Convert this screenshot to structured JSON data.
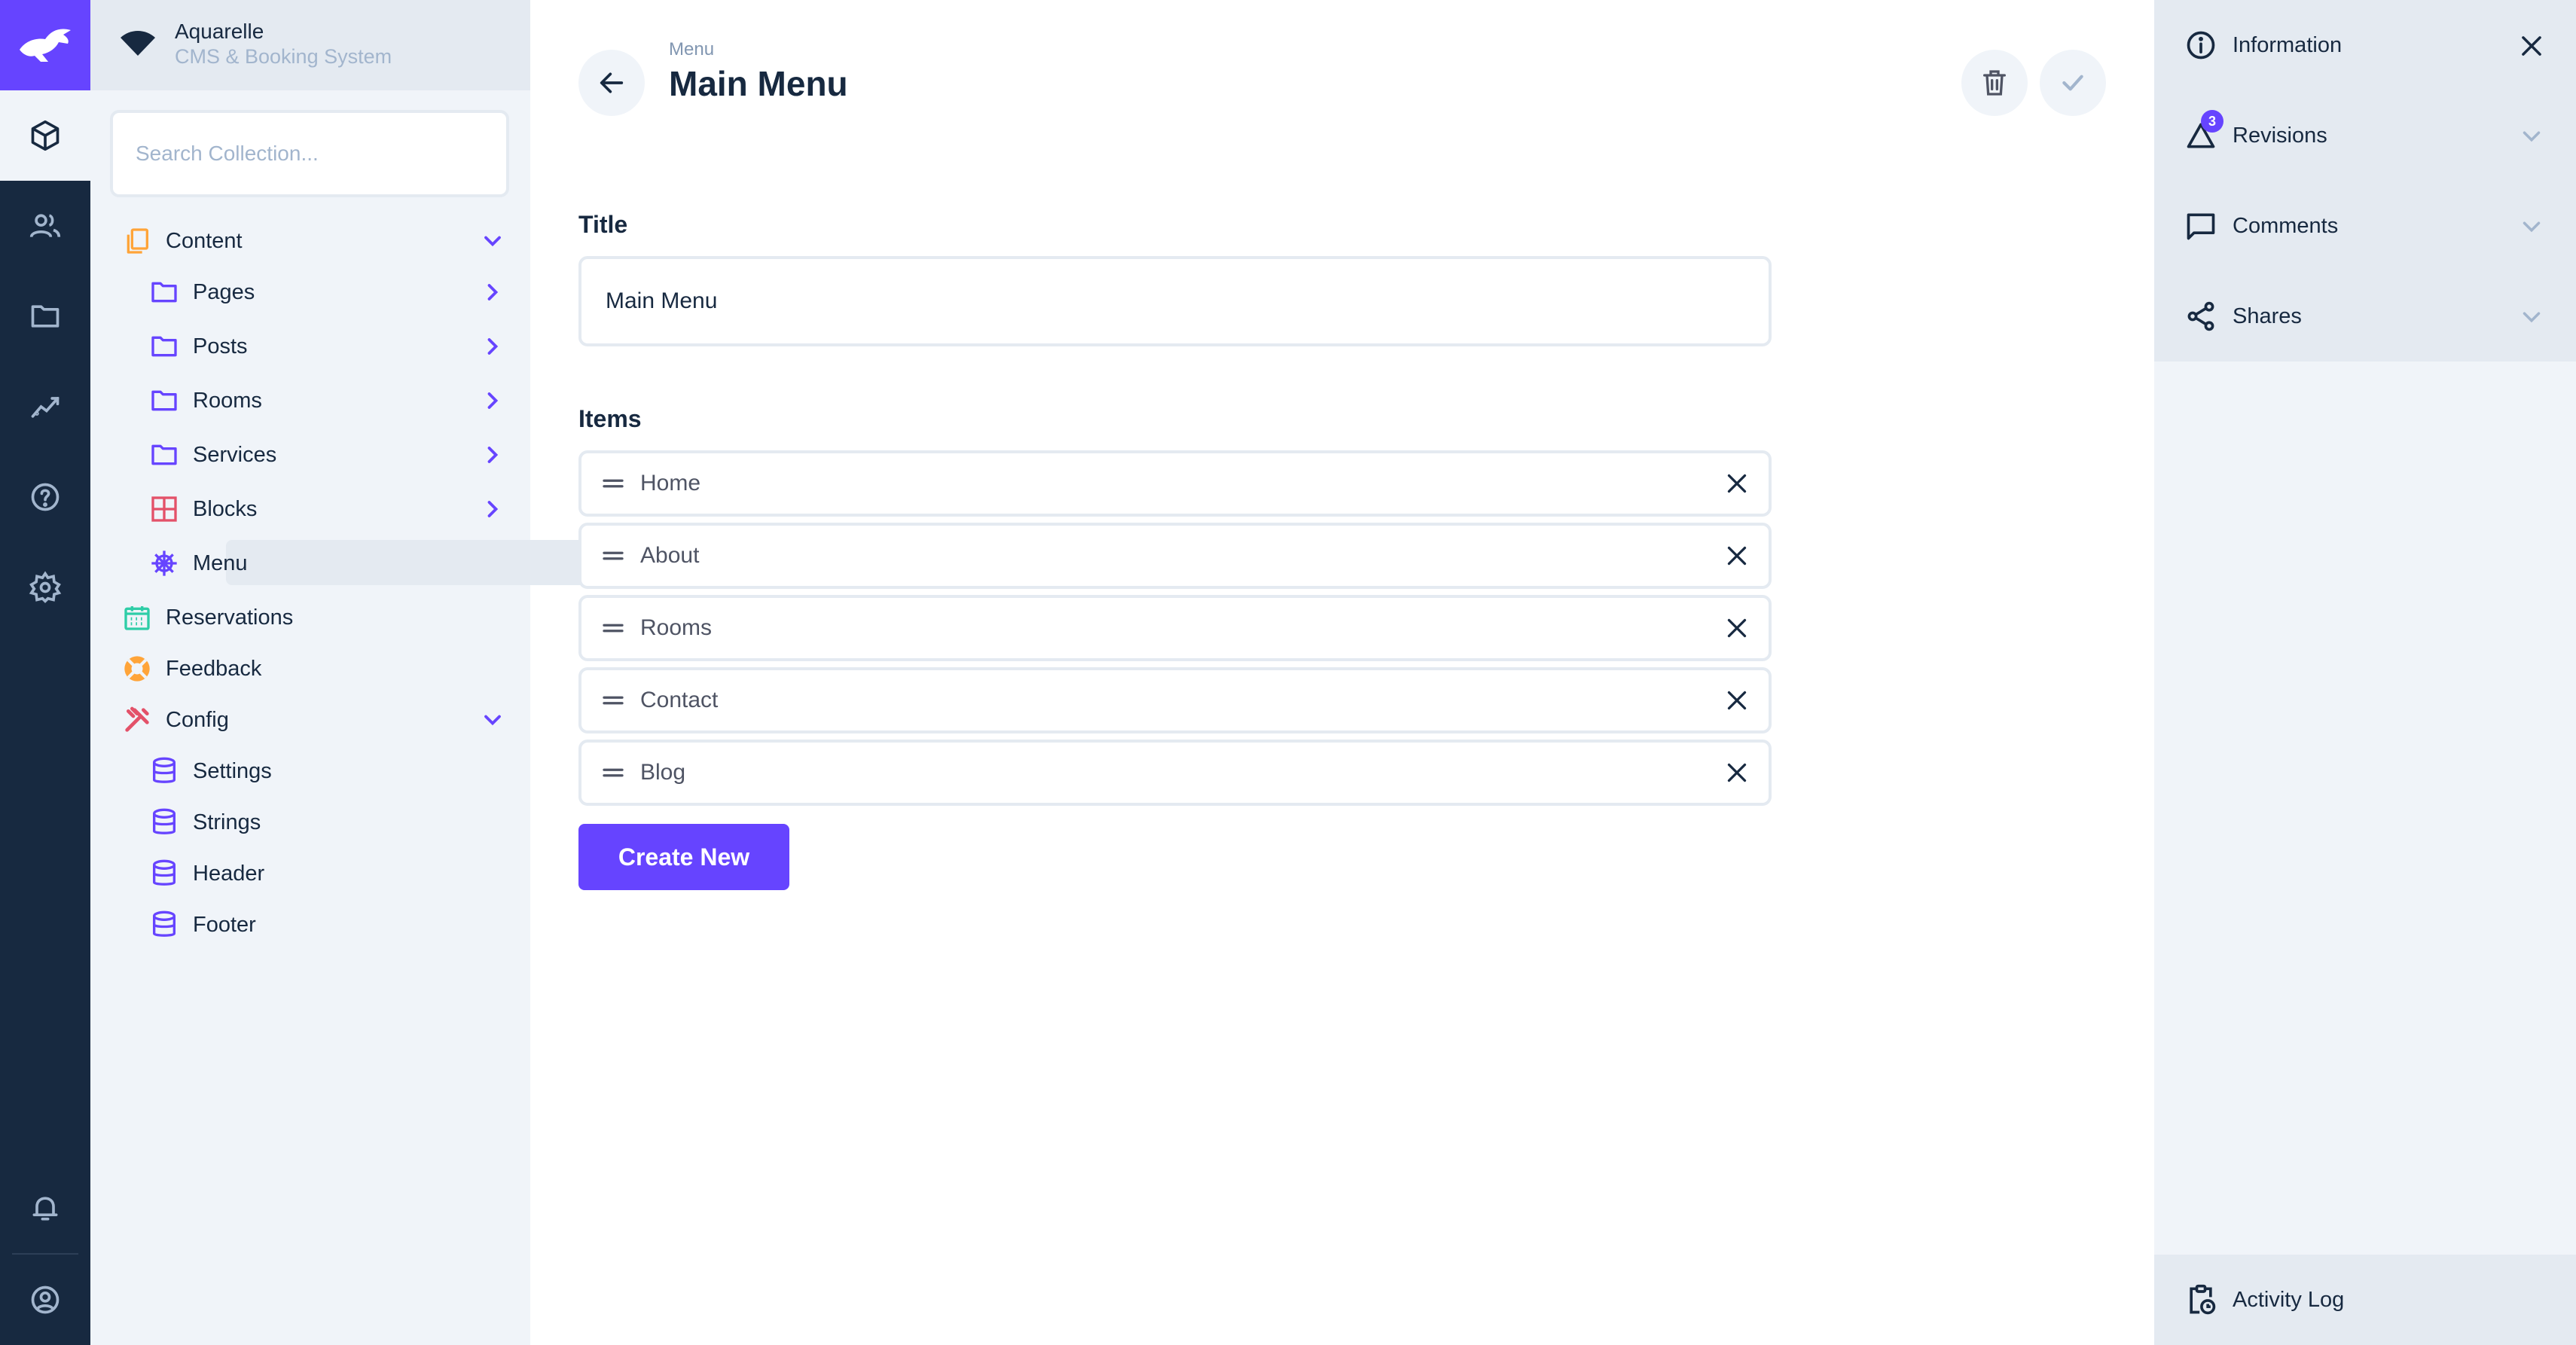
{
  "project": {
    "name": "Aquarelle",
    "description": "CMS & Booking System"
  },
  "search": {
    "placeholder": "Search Collection..."
  },
  "navigation": {
    "content": {
      "label": "Content",
      "children": [
        "Pages",
        "Posts",
        "Rooms",
        "Services",
        "Blocks",
        "Menu"
      ]
    },
    "reservations": {
      "label": "Reservations"
    },
    "feedback": {
      "label": "Feedback"
    },
    "config": {
      "label": "Config",
      "children": [
        "Settings",
        "Strings",
        "Header",
        "Footer"
      ]
    },
    "active": "Menu"
  },
  "header": {
    "breadcrumb": "Menu",
    "title": "Main Menu"
  },
  "form": {
    "title_label": "Title",
    "title_value": "Main Menu",
    "items_label": "Items",
    "items": [
      "Home",
      "About",
      "Rooms",
      "Contact",
      "Blog"
    ],
    "create_label": "Create New"
  },
  "sidebar": {
    "information": "Information",
    "revisions": "Revisions",
    "revisions_badge": "3",
    "comments": "Comments",
    "shares": "Shares",
    "activity_log": "Activity Log"
  },
  "colors": {
    "accent": "#6644ff",
    "dark": "#172940",
    "nav_bg": "#f0f4f9"
  },
  "icons": {
    "modules": [
      "box-icon",
      "users-icon",
      "folder-icon",
      "insights-icon",
      "help-icon",
      "settings-icon",
      "bell-icon",
      "account-icon"
    ]
  }
}
